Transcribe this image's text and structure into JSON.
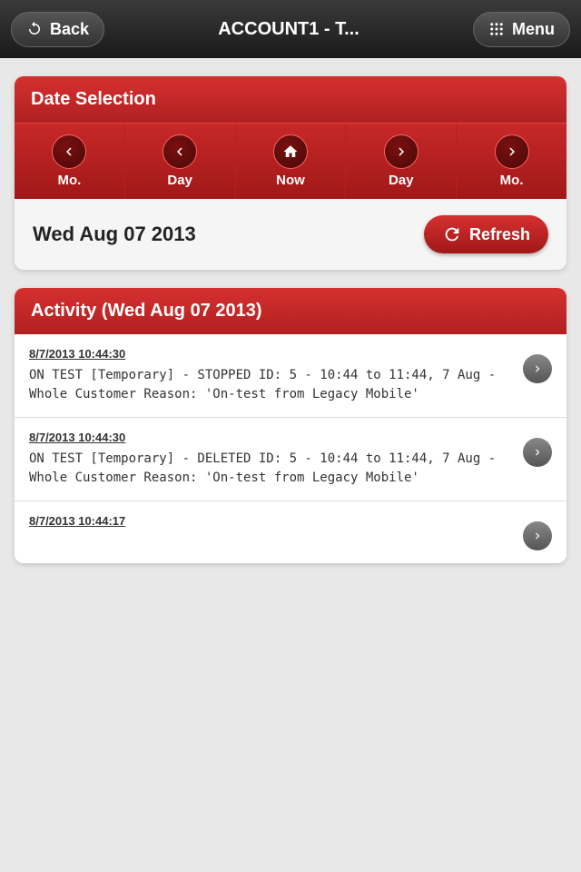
{
  "header": {
    "back_label": "Back",
    "title": "ACCOUNT1 - T...",
    "menu_label": "Menu"
  },
  "date_selection": {
    "title": "Date Selection",
    "nav_buttons": [
      {
        "icon": "chevron-left",
        "label": "Mo."
      },
      {
        "icon": "chevron-left",
        "label": "Day"
      },
      {
        "icon": "home",
        "label": "Now"
      },
      {
        "icon": "chevron-right",
        "label": "Day"
      },
      {
        "icon": "chevron-right",
        "label": "Mo."
      }
    ],
    "current_date": "Wed Aug 07 2013",
    "refresh_label": "Refresh"
  },
  "activity": {
    "title": "Activity (Wed Aug 07 2013)",
    "items": [
      {
        "time": "8/7/2013 10:44:30",
        "text": "ON TEST [Temporary] - STOPPED ID: 5 - 10:44 to 11:44, 7 Aug - Whole Customer Reason: 'On-test from Legacy Mobile'"
      },
      {
        "time": "8/7/2013 10:44:30",
        "text": "ON TEST [Temporary] - DELETED ID: 5 - 10:44 to 11:44, 7 Aug - Whole Customer Reason: 'On-test from Legacy Mobile'"
      },
      {
        "time": "8/7/2013 10:44:17",
        "text": ""
      }
    ]
  }
}
